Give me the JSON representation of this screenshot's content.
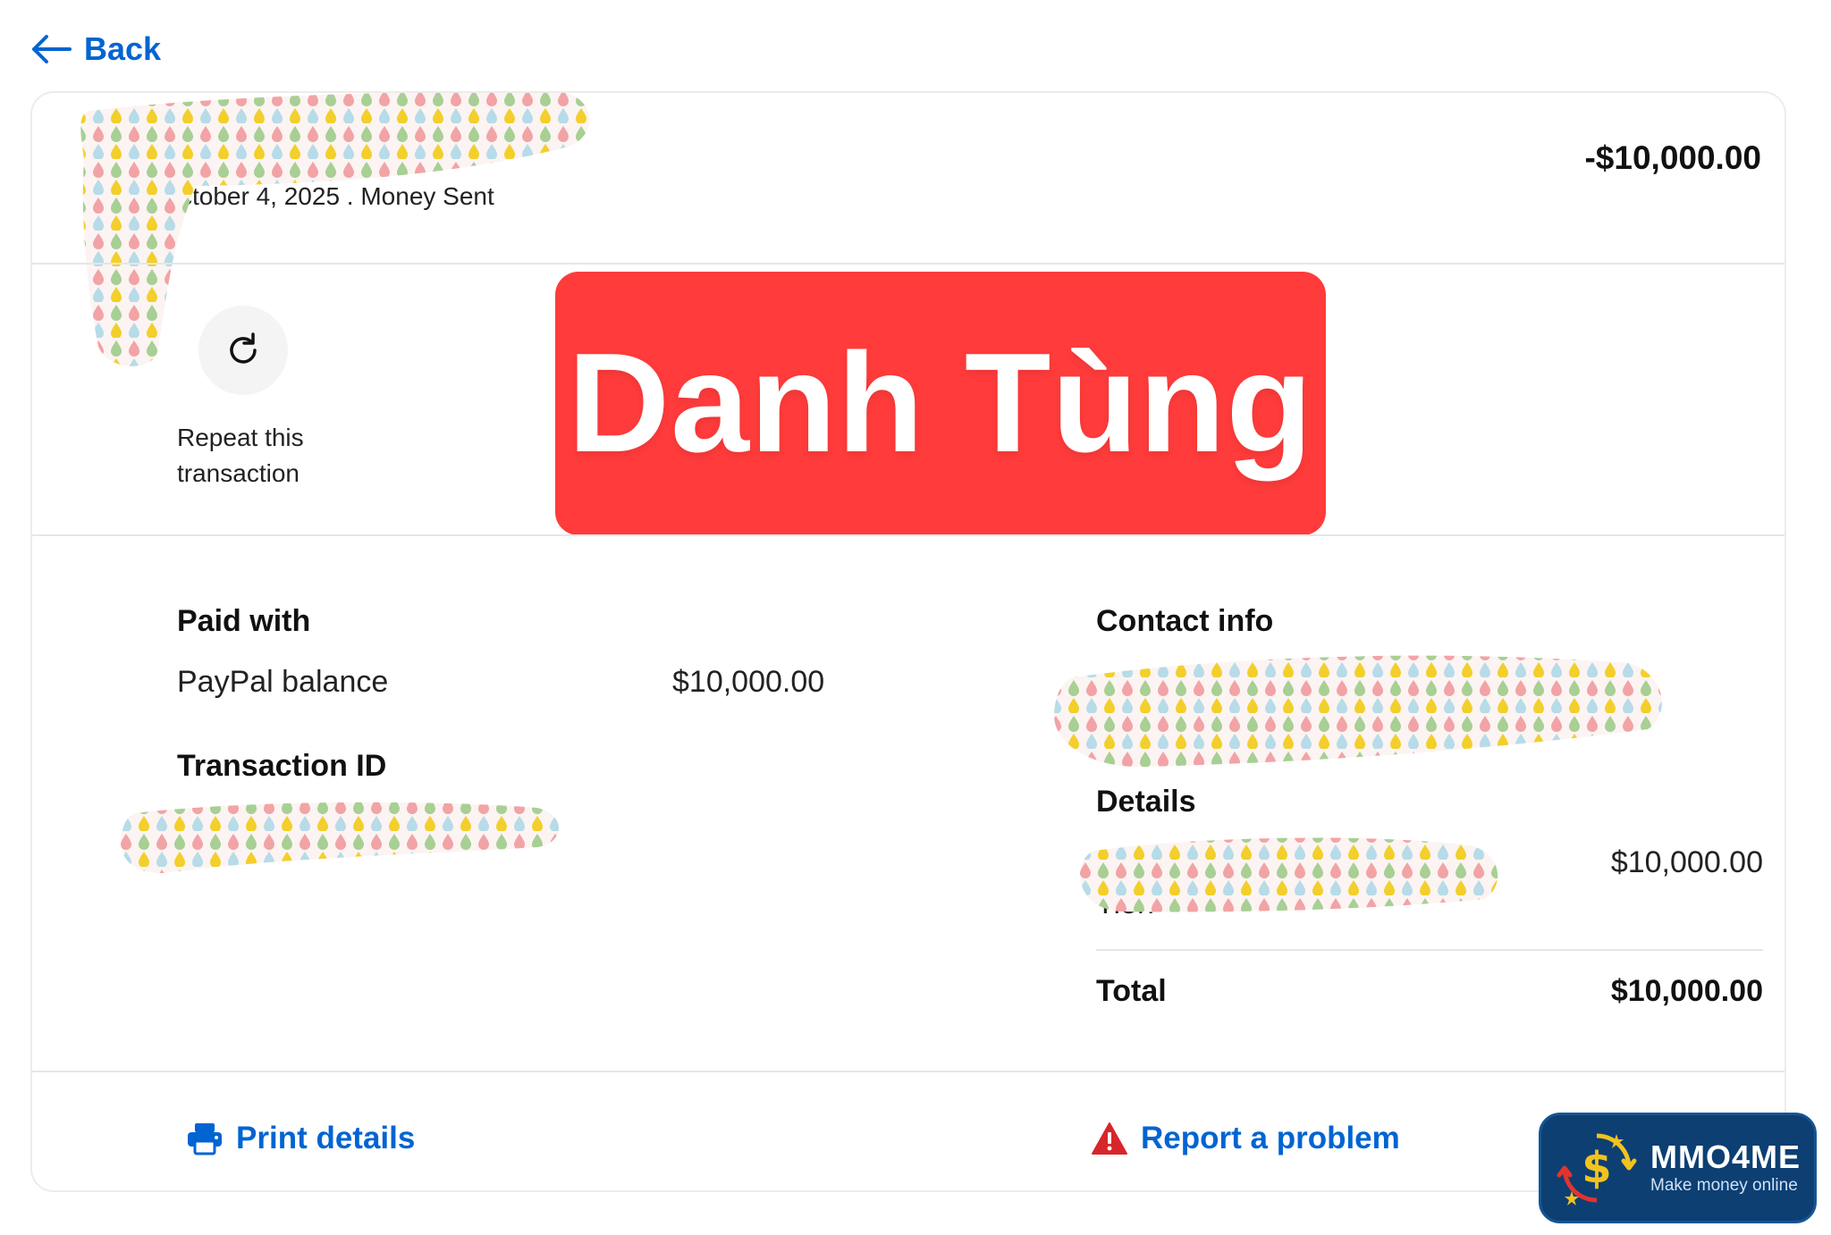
{
  "nav": {
    "back_label": "Back"
  },
  "header": {
    "subtitle": "ctober 4, 2025 . Money Sent",
    "amount": "-$10,000.00"
  },
  "actions": {
    "repeat_label": "Repeat this transaction"
  },
  "overlay": {
    "text": "Danh Tùng"
  },
  "payment": {
    "paid_with_title": "Paid with",
    "method": "PayPal balance",
    "method_amount": "$10,000.00",
    "transaction_id_title": "Transaction ID"
  },
  "contact": {
    "title": "Contact info"
  },
  "details": {
    "title": "Details",
    "item_label": "Tien",
    "item_amount": "$10,000.00",
    "total_label": "Total",
    "total_amount": "$10,000.00"
  },
  "footer": {
    "print_label": "Print details",
    "report_label": "Report a problem"
  },
  "watermark": {
    "name": "MMO4ME",
    "tagline": "Make money online"
  },
  "colors": {
    "link": "#0064d2",
    "banner": "#ff3b3b",
    "logo_bg": "#0d3f73",
    "warning": "#d7262b"
  },
  "icons": [
    "arrow-left-icon",
    "repeat-icon",
    "printer-icon",
    "warning-icon",
    "dollar-logo-icon"
  ]
}
